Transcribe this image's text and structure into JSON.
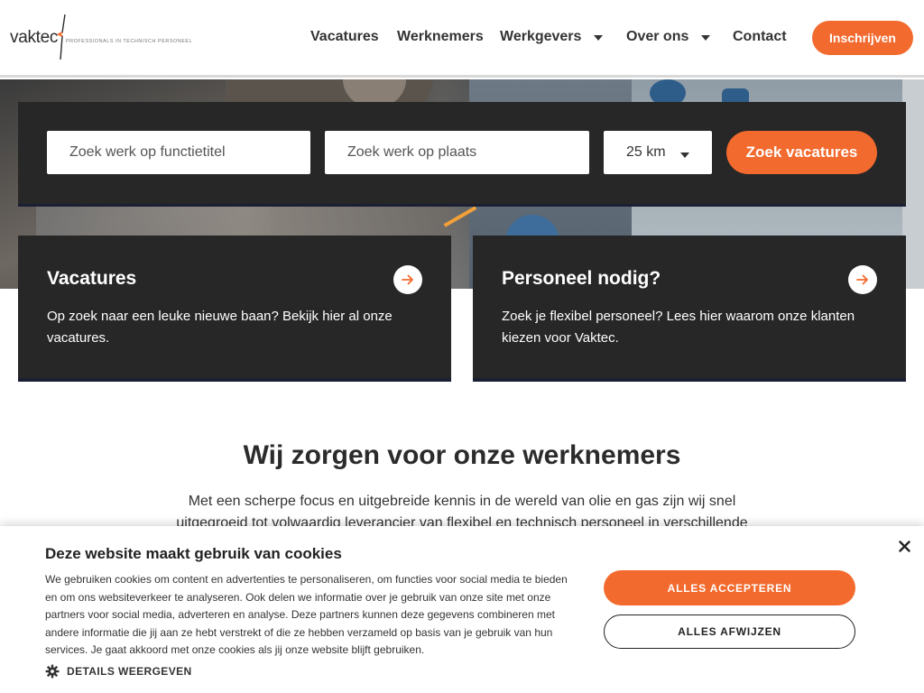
{
  "header": {
    "logo": {
      "text": "vaktec",
      "tagline": "Professionals in technisch personeel"
    },
    "nav": [
      {
        "label": "Vacatures"
      },
      {
        "label": "Werknemers"
      },
      {
        "label": "Werkgevers"
      },
      {
        "label": "Over ons"
      },
      {
        "label": "Contact"
      }
    ],
    "register_label": "Inschrijven"
  },
  "search": {
    "job_placeholder": "Zoek werk op functietitel",
    "place_placeholder": "Zoek werk op plaats",
    "radius_value": "25 km",
    "button_label": "Zoek vacatures"
  },
  "cards": [
    {
      "title": "Vacatures",
      "text": "Op zoek naar een leuke nieuwe baan? Bekijk hier al onze vacatures."
    },
    {
      "title": "Personeel nodig?",
      "text": "Zoek je flexibel personeel? Lees hier waarom onze klanten kiezen voor Vaktec."
    }
  ],
  "content": {
    "title": "Wij zorgen voor onze werknemers",
    "text": "Met een scherpe focus en uitgebreide kennis in de wereld van olie en gas zijn wij snel uitgegroeid tot volwaardig leverancier van flexibel en technisch personeel in verschillende"
  },
  "cookie": {
    "title": "Deze website maakt gebruik van cookies",
    "text": "We gebruiken cookies om content en advertenties te personaliseren, om functies voor social media te bieden en om ons websiteverkeer te analyseren. Ook delen we informatie over je gebruik van onze site met onze partners voor social media, adverteren en analyse. Deze partners kunnen deze gegevens combineren met andere informatie die jij aan ze hebt verstrekt of die ze hebben verzameld op basis van je gebruik van hun services. Je gaat akkoord met onze cookies als jij onze website blijft gebruiken.",
    "details_label": "DETAILS WEERGEVEN",
    "accept_label": "ALLES ACCEPTEREN",
    "reject_label": "ALLES AFWIJZEN"
  },
  "colors": {
    "accent": "#f26a2e",
    "panel": "#272727",
    "panel_border": "#1b1f33"
  }
}
